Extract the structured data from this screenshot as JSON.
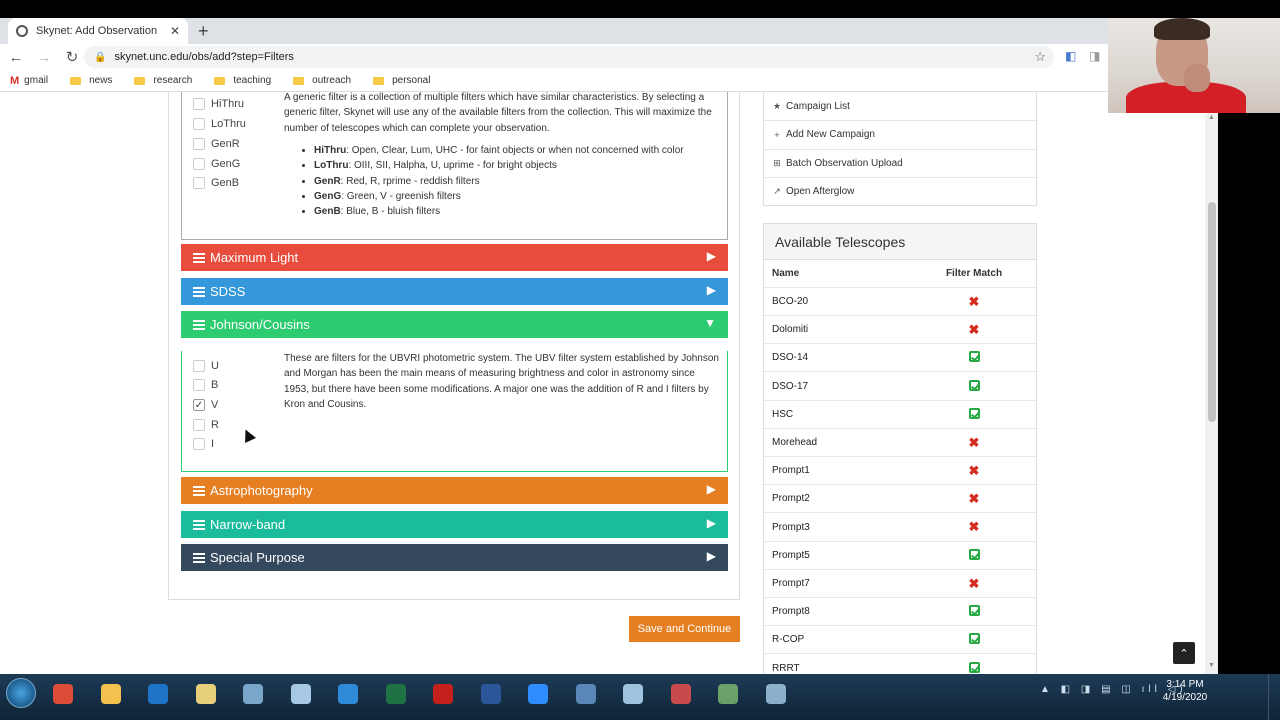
{
  "browser": {
    "tab_title": "Skynet: Add Observation",
    "url": "skynet.unc.edu/obs/add?step=Filters",
    "bookmarks": [
      "gmail",
      "news",
      "research",
      "teaching",
      "outreach",
      "personal"
    ]
  },
  "generic_filters": {
    "options": [
      "HiThru",
      "LoThru",
      "GenR",
      "GenG",
      "GenB"
    ],
    "description": "A generic filter is a collection of multiple filters which have similar characteristics. By selecting a generic filter, Skynet will use any of the available filters from the collection. This will maximize the number of telescopes which can complete your observation.",
    "desc_lines": [
      "A generic filter is a collection of multiple filters which have similar characteristics. By selecting a",
      "generic filter, Skynet will use any of the available filters from the collection. This will maximize the",
      "number of telescopes which can complete your observation."
    ],
    "details": [
      {
        "name": "HiThru",
        "text": ": Open, Clear, Lum, UHC - for faint objects or when not concerned with color"
      },
      {
        "name": "LoThru",
        "text": ": OIII, SII, Halpha, U, uprime - for bright objects"
      },
      {
        "name": "GenR",
        "text": ": Red, R, rprime - reddish filters"
      },
      {
        "name": "GenG",
        "text": ": Green, V - greenish filters"
      },
      {
        "name": "GenB",
        "text": ": Blue, B - bluish filters"
      }
    ]
  },
  "accordions": [
    {
      "label": "Maximum Light",
      "color": "#e74c3c"
    },
    {
      "label": "SDSS",
      "color": "#3498db"
    },
    {
      "label": "Johnson/Cousins",
      "color": "#2ecc71"
    },
    {
      "label": "Astrophotography",
      "color": "#e67e22"
    },
    {
      "label": "Narrow-band",
      "color": "#1abc9c"
    },
    {
      "label": "Special Purpose",
      "color": "#34495e"
    }
  ],
  "johnson_cousins": {
    "options": [
      {
        "label": "U",
        "checked": false
      },
      {
        "label": "B",
        "checked": false
      },
      {
        "label": "V",
        "checked": true
      },
      {
        "label": "R",
        "checked": false
      },
      {
        "label": "I",
        "checked": false
      }
    ],
    "desc_lines": [
      "These are filters for the UBVRI photometric system. The UBV filter system established by Johnson",
      "and Morgan has been the main means of measuring brightness and color in astronomy since",
      "1953, but there have been some modifications. A major one was the addition of R and I filters by",
      "Kron and Cousins."
    ]
  },
  "save_button": "Save and Continue",
  "links": [
    {
      "icon": "star-icon",
      "label": "Campaign List"
    },
    {
      "icon": "plus-icon",
      "label": "Add New Campaign"
    },
    {
      "icon": "plus-square-icon",
      "label": "Batch Observation Upload"
    },
    {
      "icon": "external-link-icon",
      "label": "Open Afterglow"
    }
  ],
  "telescopes": {
    "title": "Available Telescopes",
    "col_name": "Name",
    "col_match": "Filter Match",
    "rows": [
      {
        "name": "BCO-20",
        "match": false
      },
      {
        "name": "Dolomiti",
        "match": false
      },
      {
        "name": "DSO-14",
        "match": true
      },
      {
        "name": "DSO-17",
        "match": true
      },
      {
        "name": "HSC",
        "match": true
      },
      {
        "name": "Morehead",
        "match": false
      },
      {
        "name": "Prompt1",
        "match": false
      },
      {
        "name": "Prompt2",
        "match": false
      },
      {
        "name": "Prompt3",
        "match": false
      },
      {
        "name": "Prompt5",
        "match": true
      },
      {
        "name": "Prompt7",
        "match": false
      },
      {
        "name": "Prompt8",
        "match": true
      },
      {
        "name": "R-COP",
        "match": true
      },
      {
        "name": "RRRT",
        "match": true
      }
    ]
  },
  "taskbar": {
    "time": "3:14 PM",
    "date": "4/19/2020",
    "apps": [
      {
        "name": "chrome-icon",
        "color": "#dd4b39"
      },
      {
        "name": "file-explorer-icon",
        "color": "#f2c14e"
      },
      {
        "name": "outlook-icon",
        "color": "#1e74c8"
      },
      {
        "name": "folder-icon",
        "color": "#e8cf7a"
      },
      {
        "name": "calculator-icon",
        "color": "#7aa6c9"
      },
      {
        "name": "paint-icon",
        "color": "#a6c8e4"
      },
      {
        "name": "ie-icon",
        "color": "#2f8ad8"
      },
      {
        "name": "excel-icon",
        "color": "#1f7244"
      },
      {
        "name": "acrobat-icon",
        "color": "#c5201c"
      },
      {
        "name": "word-icon",
        "color": "#2b579a"
      },
      {
        "name": "zoom-icon",
        "color": "#2d8cff"
      },
      {
        "name": "screenshot-icon",
        "color": "#5b87b8"
      },
      {
        "name": "notepad-icon",
        "color": "#9fc3de"
      },
      {
        "name": "snipping-icon",
        "color": "#c74b4b"
      },
      {
        "name": "tools-icon",
        "color": "#6aa06a"
      },
      {
        "name": "network-icon",
        "color": "#8cb0cc"
      }
    ]
  }
}
